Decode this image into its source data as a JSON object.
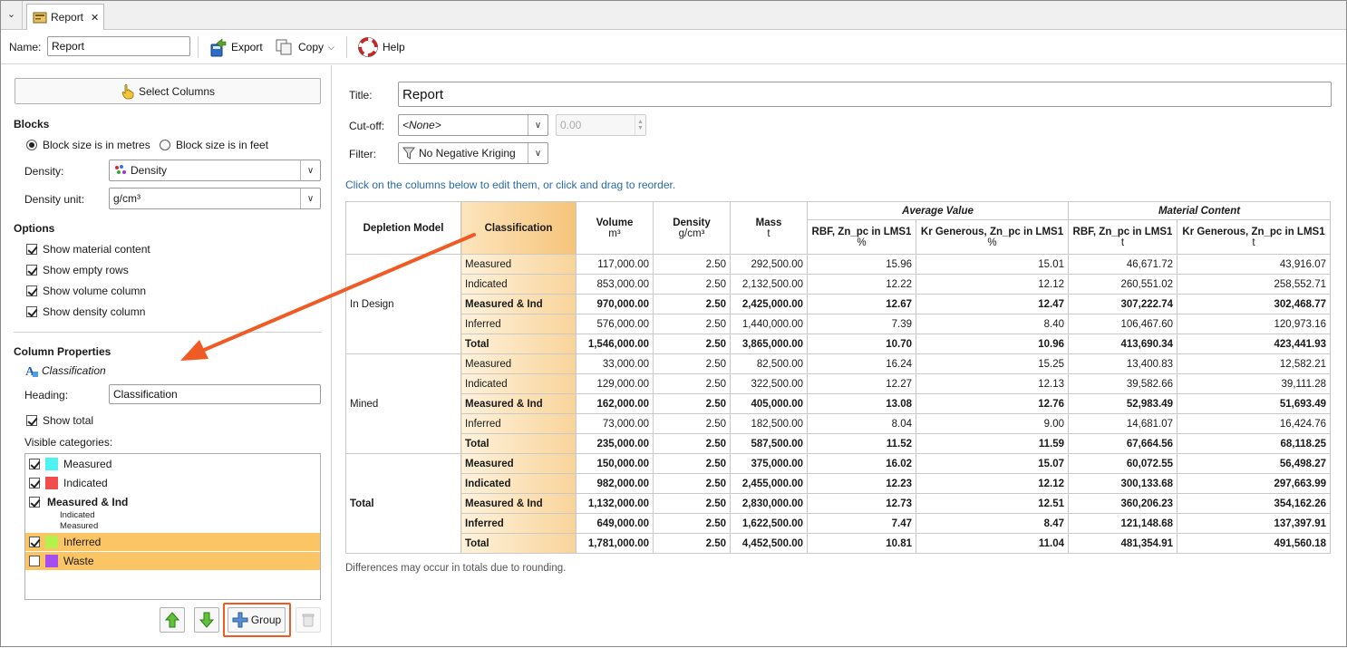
{
  "tab": {
    "title": "Report",
    "close": "✕",
    "menu": "⌄"
  },
  "toolbar": {
    "name_label": "Name:",
    "name_value": "Report",
    "export_label": "Export",
    "copy_label": "Copy",
    "help_label": "Help"
  },
  "left": {
    "select_columns": "Select Columns",
    "blocks_title": "Blocks",
    "radio_metres": "Block size is in metres",
    "radio_feet": "Block size is in feet",
    "density_label": "Density:",
    "density_value": "Density",
    "density_unit_label": "Density unit:",
    "density_unit_value": "g/cm³",
    "options_title": "Options",
    "opt_material": "Show material content",
    "opt_empty": "Show empty rows",
    "opt_volume": "Show volume column",
    "opt_density": "Show density column",
    "colprops_title": "Column Properties",
    "colprops_name": "Classification",
    "heading_label": "Heading:",
    "heading_value": "Classification",
    "show_total": "Show total",
    "visible_categories": "Visible categories:",
    "categories": [
      {
        "label": "Measured",
        "color": "#4df2f2",
        "checked": true
      },
      {
        "label": "Indicated",
        "color": "#f24d4d",
        "checked": true
      },
      {
        "label": "Measured & Ind",
        "checked": true
      },
      {
        "label": "Inferred",
        "color": "#b3f24d",
        "checked": true
      },
      {
        "label": "Waste",
        "color": "#a64df2",
        "checked": false
      }
    ],
    "group_sub": [
      "Indicated",
      "Measured"
    ],
    "group_button": "Group"
  },
  "right": {
    "title_label": "Title:",
    "title_value": "Report",
    "cutoff_label": "Cut-off:",
    "cutoff_value": "<None>",
    "cutoff_number": "0.00",
    "filter_label": "Filter:",
    "filter_value": "No Negative Kriging",
    "hint": "Click on the columns below to edit them, or click and drag to reorder.",
    "footnote": "Differences may occur in totals due to rounding."
  },
  "table": {
    "group_avg": "Average Value",
    "group_mat": "Material Content",
    "headers": [
      {
        "name": "Depletion Model",
        "unit": ""
      },
      {
        "name": "Classification",
        "unit": ""
      },
      {
        "name": "Volume",
        "unit": "m³"
      },
      {
        "name": "Density",
        "unit": "g/cm³"
      },
      {
        "name": "Mass",
        "unit": "t"
      },
      {
        "name": "RBF, Zn_pc in LMS1",
        "unit": "%"
      },
      {
        "name": "Kr Generous, Zn_pc in LMS1",
        "unit": "%"
      },
      {
        "name": "RBF, Zn_pc in LMS1",
        "unit": "t"
      },
      {
        "name": "Kr Generous, Zn_pc in LMS1",
        "unit": "t"
      }
    ],
    "groups": [
      {
        "name": "In Design",
        "rows": [
          {
            "cls": "Measured",
            "v": [
              "117,000.00",
              "2.50",
              "292,500.00",
              "15.96",
              "15.01",
              "46,671.72",
              "43,916.07"
            ],
            "bold": false
          },
          {
            "cls": "Indicated",
            "v": [
              "853,000.00",
              "2.50",
              "2,132,500.00",
              "12.22",
              "12.12",
              "260,551.02",
              "258,552.71"
            ],
            "bold": false
          },
          {
            "cls": "Measured & Ind",
            "v": [
              "970,000.00",
              "2.50",
              "2,425,000.00",
              "12.67",
              "12.47",
              "307,222.74",
              "302,468.77"
            ],
            "bold": true
          },
          {
            "cls": "Inferred",
            "v": [
              "576,000.00",
              "2.50",
              "1,440,000.00",
              "7.39",
              "8.40",
              "106,467.60",
              "120,973.16"
            ],
            "bold": false
          },
          {
            "cls": "Total",
            "v": [
              "1,546,000.00",
              "2.50",
              "3,865,000.00",
              "10.70",
              "10.96",
              "413,690.34",
              "423,441.93"
            ],
            "bold": true
          }
        ]
      },
      {
        "name": "Mined",
        "rows": [
          {
            "cls": "Measured",
            "v": [
              "33,000.00",
              "2.50",
              "82,500.00",
              "16.24",
              "15.25",
              "13,400.83",
              "12,582.21"
            ],
            "bold": false
          },
          {
            "cls": "Indicated",
            "v": [
              "129,000.00",
              "2.50",
              "322,500.00",
              "12.27",
              "12.13",
              "39,582.66",
              "39,111.28"
            ],
            "bold": false
          },
          {
            "cls": "Measured & Ind",
            "v": [
              "162,000.00",
              "2.50",
              "405,000.00",
              "13.08",
              "12.76",
              "52,983.49",
              "51,693.49"
            ],
            "bold": true
          },
          {
            "cls": "Inferred",
            "v": [
              "73,000.00",
              "2.50",
              "182,500.00",
              "8.04",
              "9.00",
              "14,681.07",
              "16,424.76"
            ],
            "bold": false
          },
          {
            "cls": "Total",
            "v": [
              "235,000.00",
              "2.50",
              "587,500.00",
              "11.52",
              "11.59",
              "67,664.56",
              "68,118.25"
            ],
            "bold": true
          }
        ]
      },
      {
        "name": "Total",
        "bold": true,
        "rows": [
          {
            "cls": "Measured",
            "v": [
              "150,000.00",
              "2.50",
              "375,000.00",
              "16.02",
              "15.07",
              "60,072.55",
              "56,498.27"
            ],
            "bold": true
          },
          {
            "cls": "Indicated",
            "v": [
              "982,000.00",
              "2.50",
              "2,455,000.00",
              "12.23",
              "12.12",
              "300,133.68",
              "297,663.99"
            ],
            "bold": true
          },
          {
            "cls": "Measured & Ind",
            "v": [
              "1,132,000.00",
              "2.50",
              "2,830,000.00",
              "12.73",
              "12.51",
              "360,206.23",
              "354,162.26"
            ],
            "bold": true
          },
          {
            "cls": "Inferred",
            "v": [
              "649,000.00",
              "2.50",
              "1,622,500.00",
              "7.47",
              "8.47",
              "121,148.68",
              "137,397.91"
            ],
            "bold": true
          },
          {
            "cls": "Total",
            "v": [
              "1,781,000.00",
              "2.50",
              "4,452,500.00",
              "10.81",
              "11.04",
              "481,354.91",
              "491,560.18"
            ],
            "bold": true
          }
        ]
      }
    ]
  },
  "colors": {
    "accent_orange": "#f05a24",
    "selection": "#fbc566",
    "link": "#2a6aa8"
  }
}
